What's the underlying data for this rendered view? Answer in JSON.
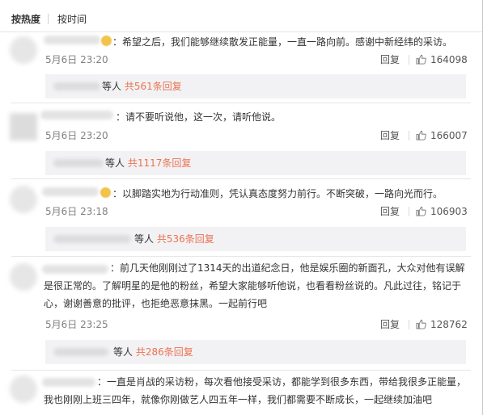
{
  "sort": {
    "hot_label": "按热度",
    "time_label": "按时间"
  },
  "comments": [
    {
      "text": "：希望之后，我们能够继续散发正能量，一直一路向前。感谢中新经纬的采访。",
      "date": "5月6日 23:20",
      "reply_label": "回复",
      "likes": "164098",
      "thread_prefix": "等人 ",
      "thread_link": "共561条回复"
    },
    {
      "text": "：请不要听说他，这一次，请听他说。",
      "date": "5月6日 23:20",
      "reply_label": "回复",
      "likes": "166007",
      "thread_prefix": "等人 ",
      "thread_link": "共1117条回复"
    },
    {
      "text": "：以脚踏实地为行动准则，凭认真态度努力前行。不断突破，一路向光而行。",
      "date": "5月6日 23:18",
      "reply_label": "回复",
      "likes": "106903",
      "thread_prefix": "等人 ",
      "thread_link": "共536条回复"
    },
    {
      "text": "：前几天他刚刚过了1314天的出道纪念日，他是娱乐圈的新面孔，大众对他有误解是很正常的。了解明星的是他的粉丝，希望大家能够听他说，也看看粉丝说的。凡此过往，铭记于心，谢谢善意的批评，也拒绝恶意抹黑。一起前行吧",
      "date": "5月6日 23:25",
      "reply_label": "回复",
      "likes": "128762",
      "thread_prefix": "等人 ",
      "thread_link": "共286条回复"
    },
    {
      "text": "：一直是肖战的采访粉，每次看他接受采访，都能学到很多东西，带给我很多正能量，我也刚刚上班三四年，就像你刚做艺人四五年一样，我们都需要不断成长，一起继续加油吧"
    }
  ],
  "icons": {
    "like": "thumbs-up-icon"
  },
  "colors": {
    "link": "#eb7350",
    "date": "#808080",
    "reply_bg": "#f2f2f5"
  }
}
